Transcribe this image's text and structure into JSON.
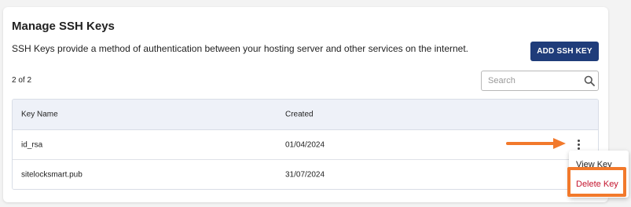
{
  "header": {
    "title": "Manage SSH Keys",
    "description": "SSH Keys provide a method of authentication between your hosting server and other services on the internet.",
    "add_button_label": "ADD SSH KEY"
  },
  "toolbar": {
    "count_text": "2 of 2",
    "search": {
      "placeholder": "Search",
      "value": "",
      "icon": "search-icon"
    }
  },
  "table": {
    "columns": [
      "Key Name",
      "Created"
    ],
    "rows": [
      {
        "name": "id_rsa",
        "created": "01/04/2024"
      },
      {
        "name": "sitelocksmart.pub",
        "created": "31/07/2024"
      }
    ]
  },
  "row_menu": {
    "items": [
      {
        "label": "View Key"
      },
      {
        "label": "Delete Key"
      }
    ]
  },
  "colors": {
    "primary_button": "#1f3c7a",
    "delete_text": "#c4142d",
    "annotation": "#f2792b",
    "table_header_bg": "#eef1f8"
  }
}
